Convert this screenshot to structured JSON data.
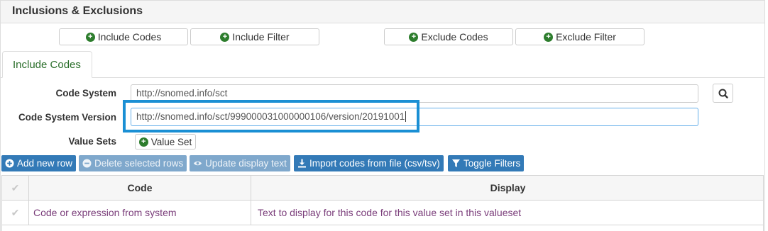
{
  "panel": {
    "title": "Inclusions & Exclusions"
  },
  "top_buttons": {
    "include_codes": "Include Codes",
    "include_filter": "Include Filter",
    "exclude_codes": "Exclude Codes",
    "exclude_filter": "Exclude Filter",
    "icon": "plus-circle-icon"
  },
  "tabs": [
    {
      "label": "Include Codes",
      "active": true
    }
  ],
  "form": {
    "code_system": {
      "label": "Code System",
      "value": "http://snomed.info/sct"
    },
    "code_system_version": {
      "label": "Code System Version",
      "value": "http://snomed.info/sct/999000031000000106/version/20191001"
    },
    "value_sets": {
      "label": "Value Sets",
      "button_label": "Value Set"
    }
  },
  "toolbar": {
    "add_row": {
      "label": "Add new row",
      "icon": "plus-circle-icon",
      "enabled": true
    },
    "delete_rows": {
      "label": "Delete selected rows",
      "icon": "minus-circle-icon",
      "enabled": false
    },
    "update_display": {
      "label": "Update display text",
      "icon": "eye-icon",
      "enabled": false
    },
    "import_codes": {
      "label": "Import codes from file (csv/tsv)",
      "icon": "import-icon",
      "enabled": true
    },
    "toggle_filters": {
      "label": "Toggle Filters",
      "icon": "filter-icon",
      "enabled": true
    }
  },
  "grid": {
    "columns": [
      "Code",
      "Display"
    ],
    "rows": [
      {
        "code": "Code or expression from system",
        "display": "Text to display for this code for this value set in this valueset"
      }
    ]
  },
  "colors": {
    "primary_button": "#337ab7",
    "disabled_button": "#7fa8cc",
    "plus_icon": "#2d7d2d",
    "highlight_box": "#1a8fd4",
    "tab_text": "#2a6e2a",
    "row_text": "#7a3d7a"
  }
}
